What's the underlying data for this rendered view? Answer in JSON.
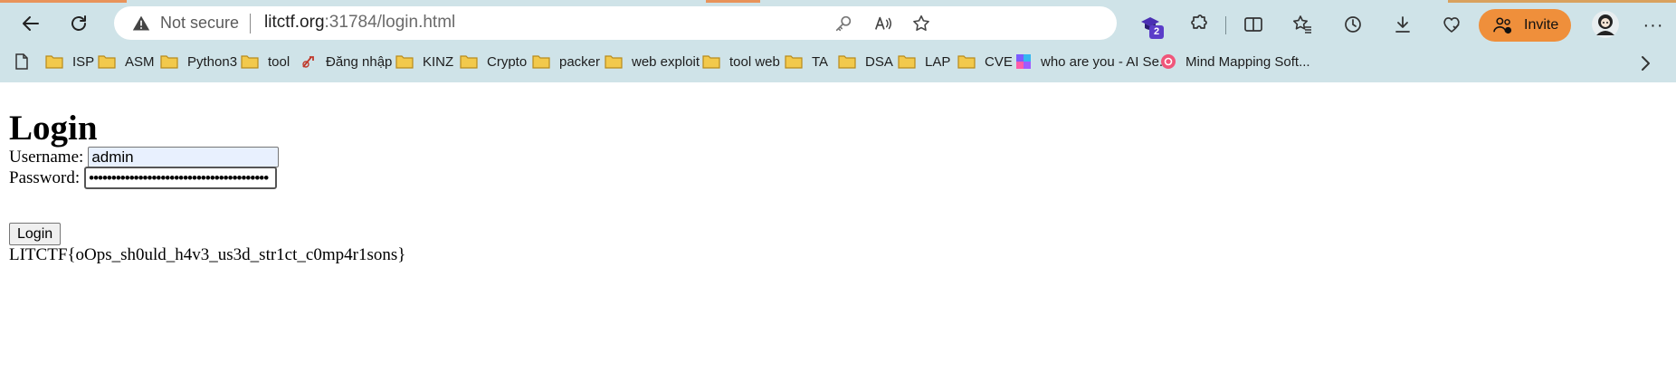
{
  "browser": {
    "security_label": "Not secure",
    "url_host": "litctf.org",
    "url_rest": ":31784/login.html",
    "extension_badge": "2",
    "invite_label": "Invite",
    "more_label": "···",
    "colors": {
      "chrome_bg": "#cfe3e8",
      "invite_bg": "#ef8f3b",
      "badge_bg": "#5b3dc9",
      "folder": "#f2c94c"
    }
  },
  "bookmarks": [
    {
      "label": "ISP",
      "icon": "folder-icon"
    },
    {
      "label": "ASM",
      "icon": "folder-icon"
    },
    {
      "label": "Python3",
      "icon": "folder-icon"
    },
    {
      "label": "tool",
      "icon": "folder-icon"
    },
    {
      "label": "Đăng nhập",
      "icon": "site-icon"
    },
    {
      "label": "KINZ",
      "icon": "folder-icon"
    },
    {
      "label": "Crypto",
      "icon": "folder-icon"
    },
    {
      "label": "packer",
      "icon": "folder-icon"
    },
    {
      "label": "web exploit",
      "icon": "folder-icon"
    },
    {
      "label": "tool web",
      "icon": "folder-icon"
    },
    {
      "label": "TA",
      "icon": "folder-icon"
    },
    {
      "label": "DSA",
      "icon": "folder-icon"
    },
    {
      "label": "LAP",
      "icon": "folder-icon"
    },
    {
      "label": "CVE",
      "icon": "folder-icon"
    },
    {
      "label": "who are you - AI Se...",
      "icon": "site-icon"
    },
    {
      "label": "Mind Mapping Soft...",
      "icon": "site-icon"
    }
  ],
  "page": {
    "title": "Login",
    "username_label": "Username:",
    "username_value": "admin",
    "password_label": "Password:",
    "password_value": "••••••••••••••••••••••••••••••••••••••••",
    "login_button": "Login",
    "flag_text": "LITCTF{oOps_sh0uld_h4v3_us3d_str1ct_c0mp4r1sons}"
  }
}
